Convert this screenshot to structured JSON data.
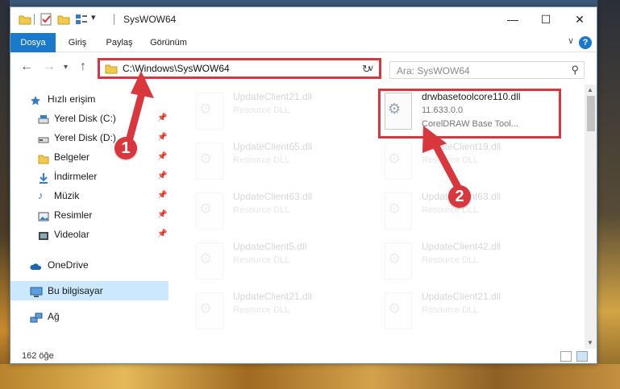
{
  "window": {
    "title": "SysWOW64",
    "qa_dropdown": "▾"
  },
  "ribbon": {
    "tabs": [
      "Dosya",
      "Giriş",
      "Paylaş",
      "Görünüm"
    ],
    "help": "?"
  },
  "nav": {
    "address": "C:\\Windows\\SysWOW64",
    "search_placeholder": "Ara: SysWOW64"
  },
  "sidebar": {
    "items": [
      {
        "label": "Hızlı erişim",
        "icon": "star-icon"
      },
      {
        "label": "Yerel Disk (C:)",
        "icon": "drive-icon",
        "pinned": true
      },
      {
        "label": "Yerel Disk (D:)",
        "icon": "drive-icon",
        "pinned": true
      },
      {
        "label": "Belgeler",
        "icon": "documents-icon",
        "pinned": true
      },
      {
        "label": "İndirmeler",
        "icon": "download-icon",
        "pinned": true
      },
      {
        "label": "Müzik",
        "icon": "music-icon",
        "pinned": true
      },
      {
        "label": "Resimler",
        "icon": "pictures-icon",
        "pinned": true
      },
      {
        "label": "Videolar",
        "icon": "videos-icon",
        "pinned": true
      },
      {
        "label": "OneDrive",
        "icon": "cloud-icon"
      },
      {
        "label": "Bu bilgisayar",
        "icon": "computer-icon",
        "selected": true
      },
      {
        "label": "Ağ",
        "icon": "network-icon"
      }
    ]
  },
  "files": [
    {
      "name": "UpdateClient21.dll",
      "type": "Resource DLL"
    },
    {
      "name": "drwbasetoolcore110.dll",
      "version": "11.633.0.0",
      "description": "CorelDRAW Base Tool..."
    },
    {
      "name": "UpdateClient65.dll",
      "type": "Resource DLL"
    },
    {
      "name": "UpdateClient19.dll",
      "type": "Resource DLL"
    },
    {
      "name": "UpdateClient63.dll",
      "type": "Resource DLL"
    },
    {
      "name": "UpdateClient63.dll",
      "type": "Resource DLL"
    },
    {
      "name": "UpdateClient5.dll",
      "type": "Resource DLL"
    },
    {
      "name": "UpdateClient42.dll",
      "type": "Resource DLL"
    },
    {
      "name": "UpdateClient21.dll",
      "type": "Resource DLL"
    },
    {
      "name": "UpdateClient21.dll",
      "type": "Resource DLL"
    }
  ],
  "status": {
    "item_count": "162 öğe"
  },
  "annotations": {
    "marker1": "1",
    "marker2": "2",
    "color": "#d9363e"
  }
}
